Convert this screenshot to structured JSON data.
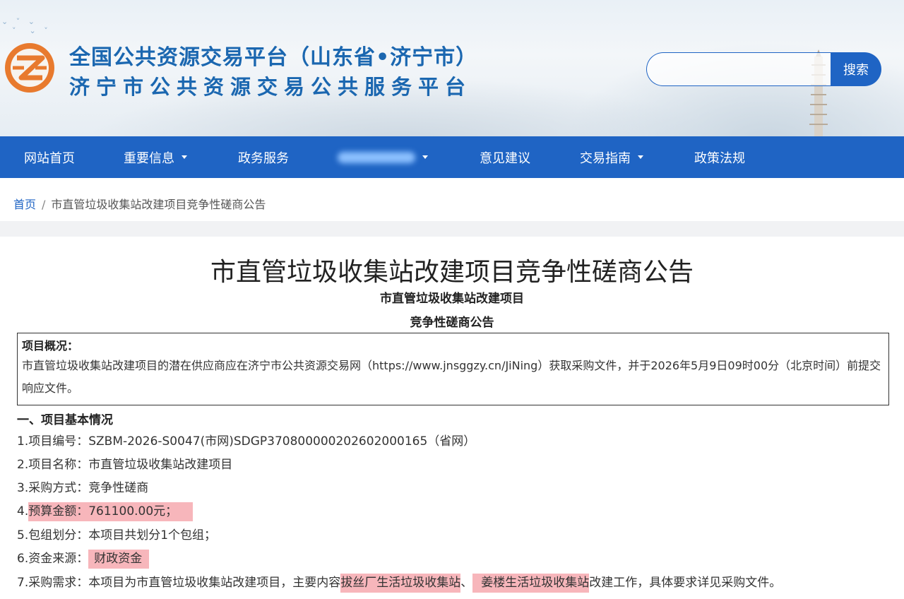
{
  "header": {
    "title_line1": "全国公共资源交易平台（山东省•济宁市）",
    "title_line2": "济宁市公共资源交易公共服务平台",
    "search_placeholder": "",
    "search_button": "搜索"
  },
  "nav": {
    "items": [
      {
        "label": "网站首页",
        "dropdown": false
      },
      {
        "label": "重要信息",
        "dropdown": true
      },
      {
        "label": "政务服务",
        "dropdown": false
      },
      {
        "label": "",
        "dropdown": true,
        "blurred": true
      },
      {
        "label": "意见建议",
        "dropdown": false
      },
      {
        "label": "交易指南",
        "dropdown": true
      },
      {
        "label": "政策法规",
        "dropdown": false
      }
    ]
  },
  "breadcrumb": {
    "home": "首页",
    "separator": "/",
    "current": "市直管垃圾收集站改建项目竞争性磋商公告"
  },
  "article": {
    "title": "市直管垃圾收集站改建项目竞争性磋商公告",
    "subtitle1": "市直管垃圾收集站改建项目",
    "subtitle2": "竞争性磋商公告",
    "overview_label": "项目概况：",
    "overview_text": "市直管垃圾收集站改建项目的潜在供应商应在济宁市公共资源交易网（https://www.jnsggzy.cn/JiNing）获取采购文件，并于2026年5月9日09时00分（北京时间）前提交响应文件。",
    "section1": "一、项目基本情况",
    "item1": "1.项目编号：SZBM-2026-S0047(市网)SDGP370800000202602000165（省网）",
    "item2": "2.项目名称：市直管垃圾收集站改建项目",
    "item3": "3.采购方式：竞争性磋商",
    "item4_prefix": "4.",
    "item4_highlight": "预算金额：761100.00元；",
    "item5": "5.包组划分：本项目共划分1个包组；",
    "item6_prefix": "6.资金来源：",
    "item6_highlight": "财政资金",
    "item7_part1": "7.采购需求：本项目为市直管垃圾收集站改建项目，主要内容",
    "item7_highlight1": "拔丝厂生活垃圾收集站",
    "item7_sep": "、",
    "item7_highlight2": "姜楼生活垃圾收集站",
    "item7_part2": "改建工作，具体要求详见采购文件。"
  },
  "colors": {
    "brand_blue": "#1f64c4",
    "title_blue": "#1b67b0",
    "logo_orange": "#e87a2e",
    "highlight": "#f7b6bb"
  }
}
